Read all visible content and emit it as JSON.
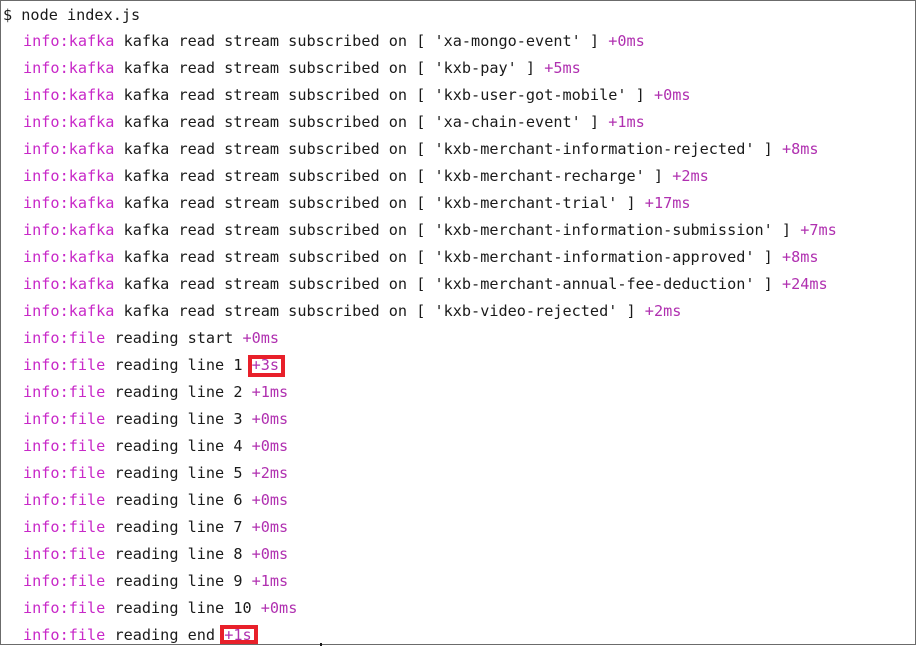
{
  "terminal": {
    "prompt": "$ node index.js",
    "lines": [
      {
        "ns": "info:kafka",
        "msg": "kafka read stream subscribed on [ 'xa-mongo-event' ]",
        "delta": "+0ms"
      },
      {
        "ns": "info:kafka",
        "msg": "kafka read stream subscribed on [ 'kxb-pay' ]",
        "delta": "+5ms"
      },
      {
        "ns": "info:kafka",
        "msg": "kafka read stream subscribed on [ 'kxb-user-got-mobile' ]",
        "delta": "+0ms"
      },
      {
        "ns": "info:kafka",
        "msg": "kafka read stream subscribed on [ 'xa-chain-event' ]",
        "delta": "+1ms"
      },
      {
        "ns": "info:kafka",
        "msg": "kafka read stream subscribed on [ 'kxb-merchant-information-rejected' ]",
        "delta": "+8ms"
      },
      {
        "ns": "info:kafka",
        "msg": "kafka read stream subscribed on [ 'kxb-merchant-recharge' ]",
        "delta": "+2ms"
      },
      {
        "ns": "info:kafka",
        "msg": "kafka read stream subscribed on [ 'kxb-merchant-trial' ]",
        "delta": "+17ms"
      },
      {
        "ns": "info:kafka",
        "msg": "kafka read stream subscribed on [ 'kxb-merchant-information-submission' ]",
        "delta": "+7ms"
      },
      {
        "ns": "info:kafka",
        "msg": "kafka read stream subscribed on [ 'kxb-merchant-information-approved' ]",
        "delta": "+8ms"
      },
      {
        "ns": "info:kafka",
        "msg": "kafka read stream subscribed on [ 'kxb-merchant-annual-fee-deduction' ]",
        "delta": "+24ms"
      },
      {
        "ns": "info:kafka",
        "msg": "kafka read stream subscribed on [ 'kxb-video-rejected' ]",
        "delta": "+2ms"
      },
      {
        "ns": "info:file",
        "msg": "reading start",
        "delta": "+0ms"
      },
      {
        "ns": "info:file",
        "msg": "reading line 1",
        "delta": "+3s",
        "highlight": true
      },
      {
        "ns": "info:file",
        "msg": "reading line 2",
        "delta": "+1ms"
      },
      {
        "ns": "info:file",
        "msg": "reading line 3",
        "delta": "+0ms"
      },
      {
        "ns": "info:file",
        "msg": "reading line 4",
        "delta": "+0ms"
      },
      {
        "ns": "info:file",
        "msg": "reading line 5",
        "delta": "+2ms"
      },
      {
        "ns": "info:file",
        "msg": "reading line 6",
        "delta": "+0ms"
      },
      {
        "ns": "info:file",
        "msg": "reading line 7",
        "delta": "+0ms"
      },
      {
        "ns": "info:file",
        "msg": "reading line 8",
        "delta": "+0ms"
      },
      {
        "ns": "info:file",
        "msg": "reading line 9",
        "delta": "+1ms"
      },
      {
        "ns": "info:file",
        "msg": "reading line 10",
        "delta": "+0ms"
      },
      {
        "ns": "info:file",
        "msg": "reading end",
        "delta": "+1s",
        "highlight": true
      }
    ]
  },
  "colors": {
    "namespace": "#c828c8",
    "delta": "#b030b0",
    "text": "#1a1a1a",
    "highlight_box": "#e8202a"
  }
}
